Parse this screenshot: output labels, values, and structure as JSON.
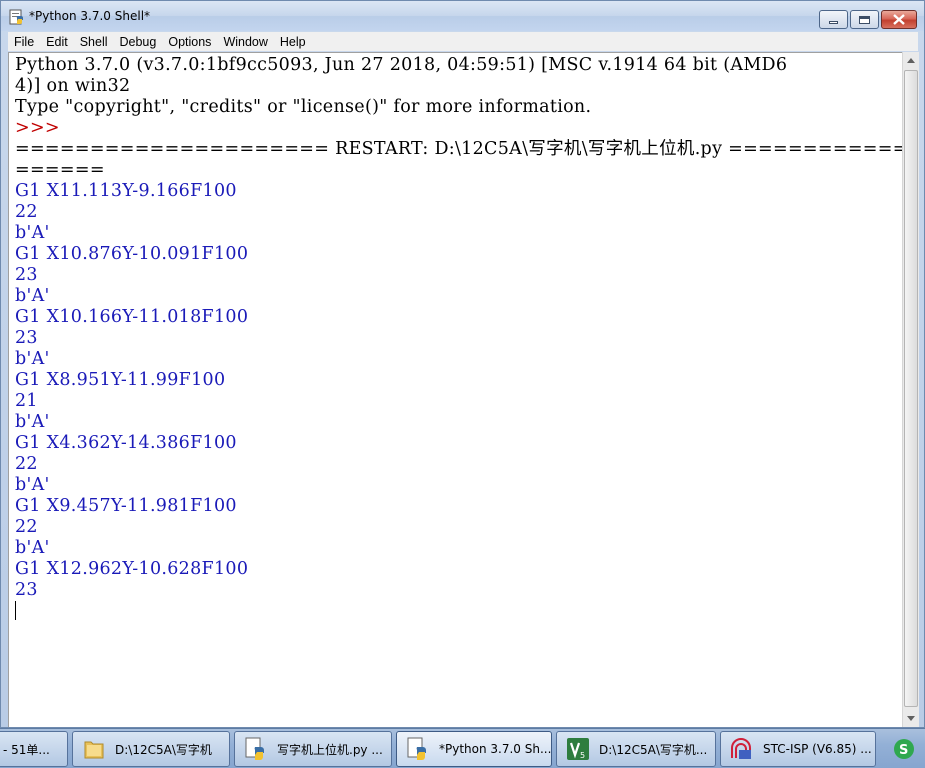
{
  "window": {
    "title": "*Python 3.7.0 Shell*"
  },
  "menu": {
    "items": [
      "File",
      "Edit",
      "Shell",
      "Debug",
      "Options",
      "Window",
      "Help"
    ]
  },
  "console": {
    "lines": [
      {
        "text": "Python 3.7.0 (v3.7.0:1bf9cc5093, Jun 27 2018, 04:59:51) [MSC v.1914 64 bit (AMD6",
        "color": "#000000"
      },
      {
        "text": "4)] on win32",
        "color": "#000000"
      },
      {
        "text": "Type \"copyright\", \"credits\" or \"license()\" for more information.",
        "color": "#000000"
      },
      {
        "text": ">>> ",
        "color": "#c00000"
      },
      {
        "text": "===================== RESTART: D:\\12C5A\\写字机\\写字机上位机.py ================",
        "color": "#000000"
      },
      {
        "text": "======",
        "color": "#000000"
      },
      {
        "text": "G1 X11.113Y-9.166F100",
        "color": "#1a1ab8"
      },
      {
        "text": "22",
        "color": "#1a1ab8"
      },
      {
        "text": "b'A'",
        "color": "#1a1ab8"
      },
      {
        "text": "G1 X10.876Y-10.091F100",
        "color": "#1a1ab8"
      },
      {
        "text": "23",
        "color": "#1a1ab8"
      },
      {
        "text": "b'A'",
        "color": "#1a1ab8"
      },
      {
        "text": "G1 X10.166Y-11.018F100",
        "color": "#1a1ab8"
      },
      {
        "text": "23",
        "color": "#1a1ab8"
      },
      {
        "text": "b'A'",
        "color": "#1a1ab8"
      },
      {
        "text": "G1 X8.951Y-11.99F100",
        "color": "#1a1ab8"
      },
      {
        "text": "21",
        "color": "#1a1ab8"
      },
      {
        "text": "b'A'",
        "color": "#1a1ab8"
      },
      {
        "text": "G1 X4.362Y-14.386F100",
        "color": "#1a1ab8"
      },
      {
        "text": "22",
        "color": "#1a1ab8"
      },
      {
        "text": "b'A'",
        "color": "#1a1ab8"
      },
      {
        "text": "G1 X9.457Y-11.981F100",
        "color": "#1a1ab8"
      },
      {
        "text": "22",
        "color": "#1a1ab8"
      },
      {
        "text": "b'A'",
        "color": "#1a1ab8"
      },
      {
        "text": "G1 X12.962Y-10.628F100",
        "color": "#1a1ab8"
      },
      {
        "text": "23",
        "color": "#1a1ab8"
      }
    ]
  },
  "taskbar": {
    "items": [
      {
        "label": "- 51单...",
        "icon": "app-icon"
      },
      {
        "label": "D:\\12C5A\\写字机",
        "icon": "folder-icon"
      },
      {
        "label": "写字机上位机.py ...",
        "icon": "python-editor-icon"
      },
      {
        "label": "*Python 3.7.0 Sh...",
        "icon": "python-shell-icon"
      },
      {
        "label": "D:\\12C5A\\写字机...",
        "icon": "vs-icon"
      },
      {
        "label": "STC-ISP (V6.85) ...",
        "icon": "stc-isp-icon"
      }
    ],
    "tray_icon": "sogou-ime-icon"
  }
}
